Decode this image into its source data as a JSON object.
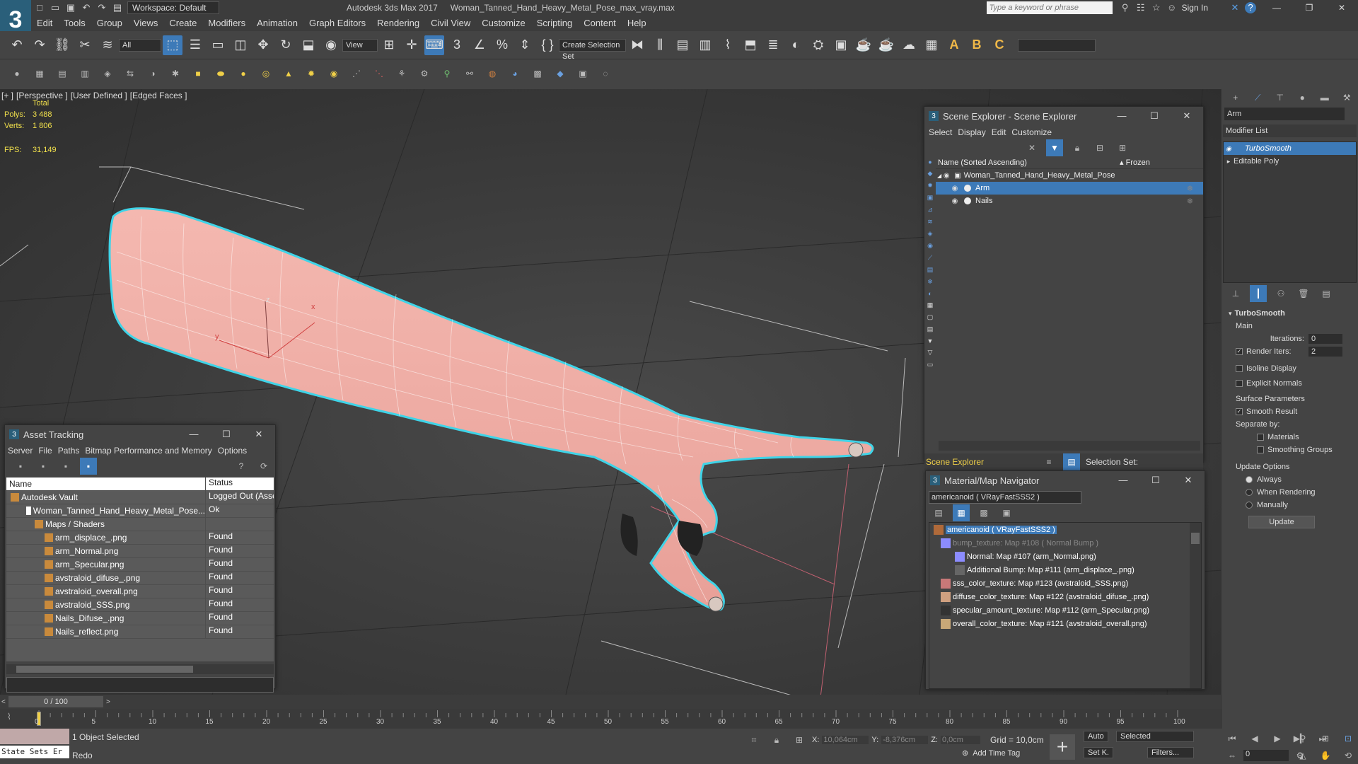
{
  "app": {
    "logo": "3",
    "workspace": "Workspace: Default",
    "title": "Autodesk 3ds Max 2017",
    "filename": "Woman_Tanned_Hand_Heavy_Metal_Pose_max_vray.max",
    "search_placeholder": "Type a keyword or phrase",
    "sign_in": "Sign In"
  },
  "menu": [
    "Edit",
    "Tools",
    "Group",
    "Views",
    "Create",
    "Modifiers",
    "Animation",
    "Graph Editors",
    "Rendering",
    "Civil View",
    "Customize",
    "Scripting",
    "Content",
    "Help"
  ],
  "toolbar": {
    "filter": "All",
    "ref_coord": "View",
    "selection_set": "Create Selection Set"
  },
  "viewport": {
    "label_plus": "[+ ]",
    "label_view": "[Perspective ]",
    "label_shading": "[User Defined ]",
    "label_faces": "[Edged Faces ]",
    "stats_total": "Total",
    "polys_label": "Polys:",
    "polys_value": "3 488",
    "verts_label": "Verts:",
    "verts_value": "1 806",
    "fps_label": "FPS:",
    "fps_value": "31,149",
    "axis_x": "x",
    "axis_y": "y",
    "axis_z": "z"
  },
  "asset_tracking": {
    "title": "Asset Tracking",
    "menu": [
      "Server",
      "File",
      "Paths",
      "Bitmap Performance and Memory",
      "Options"
    ],
    "col_name": "Name",
    "col_status": "Status",
    "rows": [
      {
        "name": "Autodesk Vault",
        "status": "Logged Out (Asse"
      },
      {
        "name": "Woman_Tanned_Hand_Heavy_Metal_Pose...",
        "status": "Ok"
      },
      {
        "name": "Maps / Shaders",
        "status": ""
      },
      {
        "name": "arm_displace_.png",
        "status": "Found"
      },
      {
        "name": "arm_Normal.png",
        "status": "Found"
      },
      {
        "name": "arm_Specular.png",
        "status": "Found"
      },
      {
        "name": "avstraloid_difuse_.png",
        "status": "Found"
      },
      {
        "name": "avstraloid_overall.png",
        "status": "Found"
      },
      {
        "name": "avstraloid_SSS.png",
        "status": "Found"
      },
      {
        "name": "Nails_Difuse_.png",
        "status": "Found"
      },
      {
        "name": "Nails_reflect.png",
        "status": "Found"
      }
    ]
  },
  "scene_explorer": {
    "title": "Scene Explorer - Scene Explorer",
    "menu": [
      "Select",
      "Display",
      "Edit",
      "Customize"
    ],
    "col_name": "Name (Sorted Ascending)",
    "col_frozen": "▴ Frozen",
    "root": "Woman_Tanned_Hand_Heavy_Metal_Pose",
    "children": [
      "Arm",
      "Nails"
    ],
    "footer_name": "Scene Explorer",
    "selection_set": "Selection Set:"
  },
  "material_nav": {
    "title": "Material/Map Navigator",
    "field": "americanoid  ( VRayFastSSS2 )",
    "rows": [
      {
        "text": "americanoid  ( VRayFastSSS2 )",
        "color": "#b06a3a"
      },
      {
        "text": "bump_texture: Map #108  ( Normal Bump )",
        "color": "#8c8cff"
      },
      {
        "text": "Normal: Map #107 (arm_Normal.png)",
        "color": "#8c8cff"
      },
      {
        "text": "Additional Bump: Map #111 (arm_displace_.png)",
        "color": "#666666"
      },
      {
        "text": "sss_color_texture: Map #123 (avstraloid_SSS.png)",
        "color": "#c87878"
      },
      {
        "text": "diffuse_color_texture: Map #122 (avstraloid_difuse_.png)",
        "color": "#d0a080"
      },
      {
        "text": "specular_amount_texture: Map #112 (arm_Specular.png)",
        "color": "#333333"
      },
      {
        "text": "overall_color_texture: Map #121 (avstraloid_overall.png)",
        "color": "#c8a878"
      }
    ]
  },
  "command_panel": {
    "object_name": "Arm",
    "modifier_list": "Modifier List",
    "stack": [
      "TurboSmooth",
      "Editable Poly"
    ],
    "turbosmooth": {
      "title": "TurboSmooth",
      "main": "Main",
      "iterations_label": "Iterations:",
      "iterations": "0",
      "render_iters_label": "Render Iters:",
      "render_iters": "2",
      "isoline": "Isoline Display",
      "explicit_normals": "Explicit Normals",
      "surface_params": "Surface Parameters",
      "smooth_result": "Smooth Result",
      "separate_by": "Separate by:",
      "materials": "Materials",
      "smoothing_groups": "Smoothing Groups",
      "update_options": "Update Options",
      "always": "Always",
      "when_rendering": "When Rendering",
      "manually": "Manually",
      "update": "Update"
    }
  },
  "timeline": {
    "frame": "0 / 100",
    "ticks": [
      "0",
      "5",
      "10",
      "15",
      "20",
      "25",
      "30",
      "35",
      "40",
      "45",
      "50",
      "55",
      "60",
      "65",
      "70",
      "75",
      "80",
      "85",
      "90",
      "95",
      "100"
    ]
  },
  "status": {
    "maxscript": "State Sets Er",
    "selected": "1 Object Selected",
    "prompt": "Redo",
    "x_label": "X:",
    "x_val": "10,064cm",
    "y_label": "Y:",
    "y_val": "-8,376cm",
    "z_label": "Z:",
    "z_val": "0,0cm",
    "grid": "Grid = 10,0cm",
    "add_time_tag": "Add Time Tag",
    "auto": "Auto",
    "set_key": "Set K.",
    "key_filter": "Selected",
    "filters": "Filters...",
    "frame_field": "0"
  }
}
